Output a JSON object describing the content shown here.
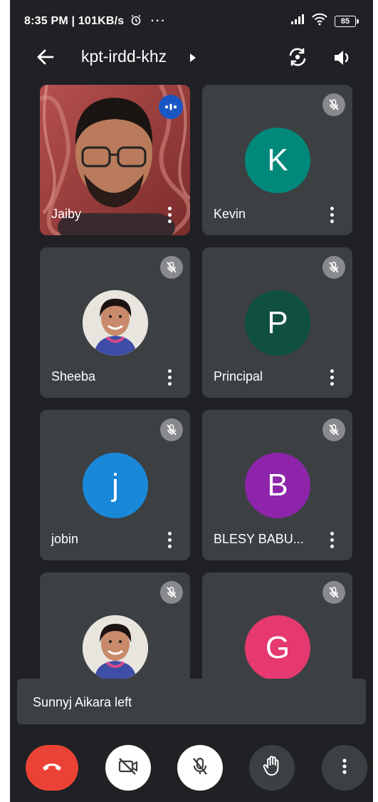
{
  "status_bar": {
    "time_speed": "8:35 PM | 101KB/s",
    "more": "···",
    "battery": "85"
  },
  "header": {
    "meeting_code": "kpt-irdd-khz"
  },
  "participants": [
    {
      "name": "Jaiby",
      "type": "video",
      "speaking": true
    },
    {
      "name": "Kevin",
      "initial": "K",
      "color": "#00897b",
      "muted": true
    },
    {
      "name": "Sheeba",
      "type": "photo",
      "muted": true
    },
    {
      "name": "Principal",
      "initial": "P",
      "color": "#0f5040",
      "muted": true
    },
    {
      "name": "jobin",
      "initial": "j",
      "color": "#1a88d8",
      "muted": true
    },
    {
      "name": "BLESY BABU...",
      "initial": "B",
      "color": "#8e24aa",
      "muted": true
    },
    {
      "name": "",
      "type": "photo",
      "muted": true
    },
    {
      "name": "",
      "initial": "G",
      "color": "#e53970",
      "muted": true
    }
  ],
  "toast": {
    "message": "Sunnyj Aikara left"
  },
  "controls": {
    "end_call_icon": "hang-up-icon",
    "camera_icon": "camera-off-icon",
    "mic_icon": "mic-off-icon",
    "raise_hand_icon": "raise-hand-icon",
    "more_icon": "more-vert-icon"
  }
}
